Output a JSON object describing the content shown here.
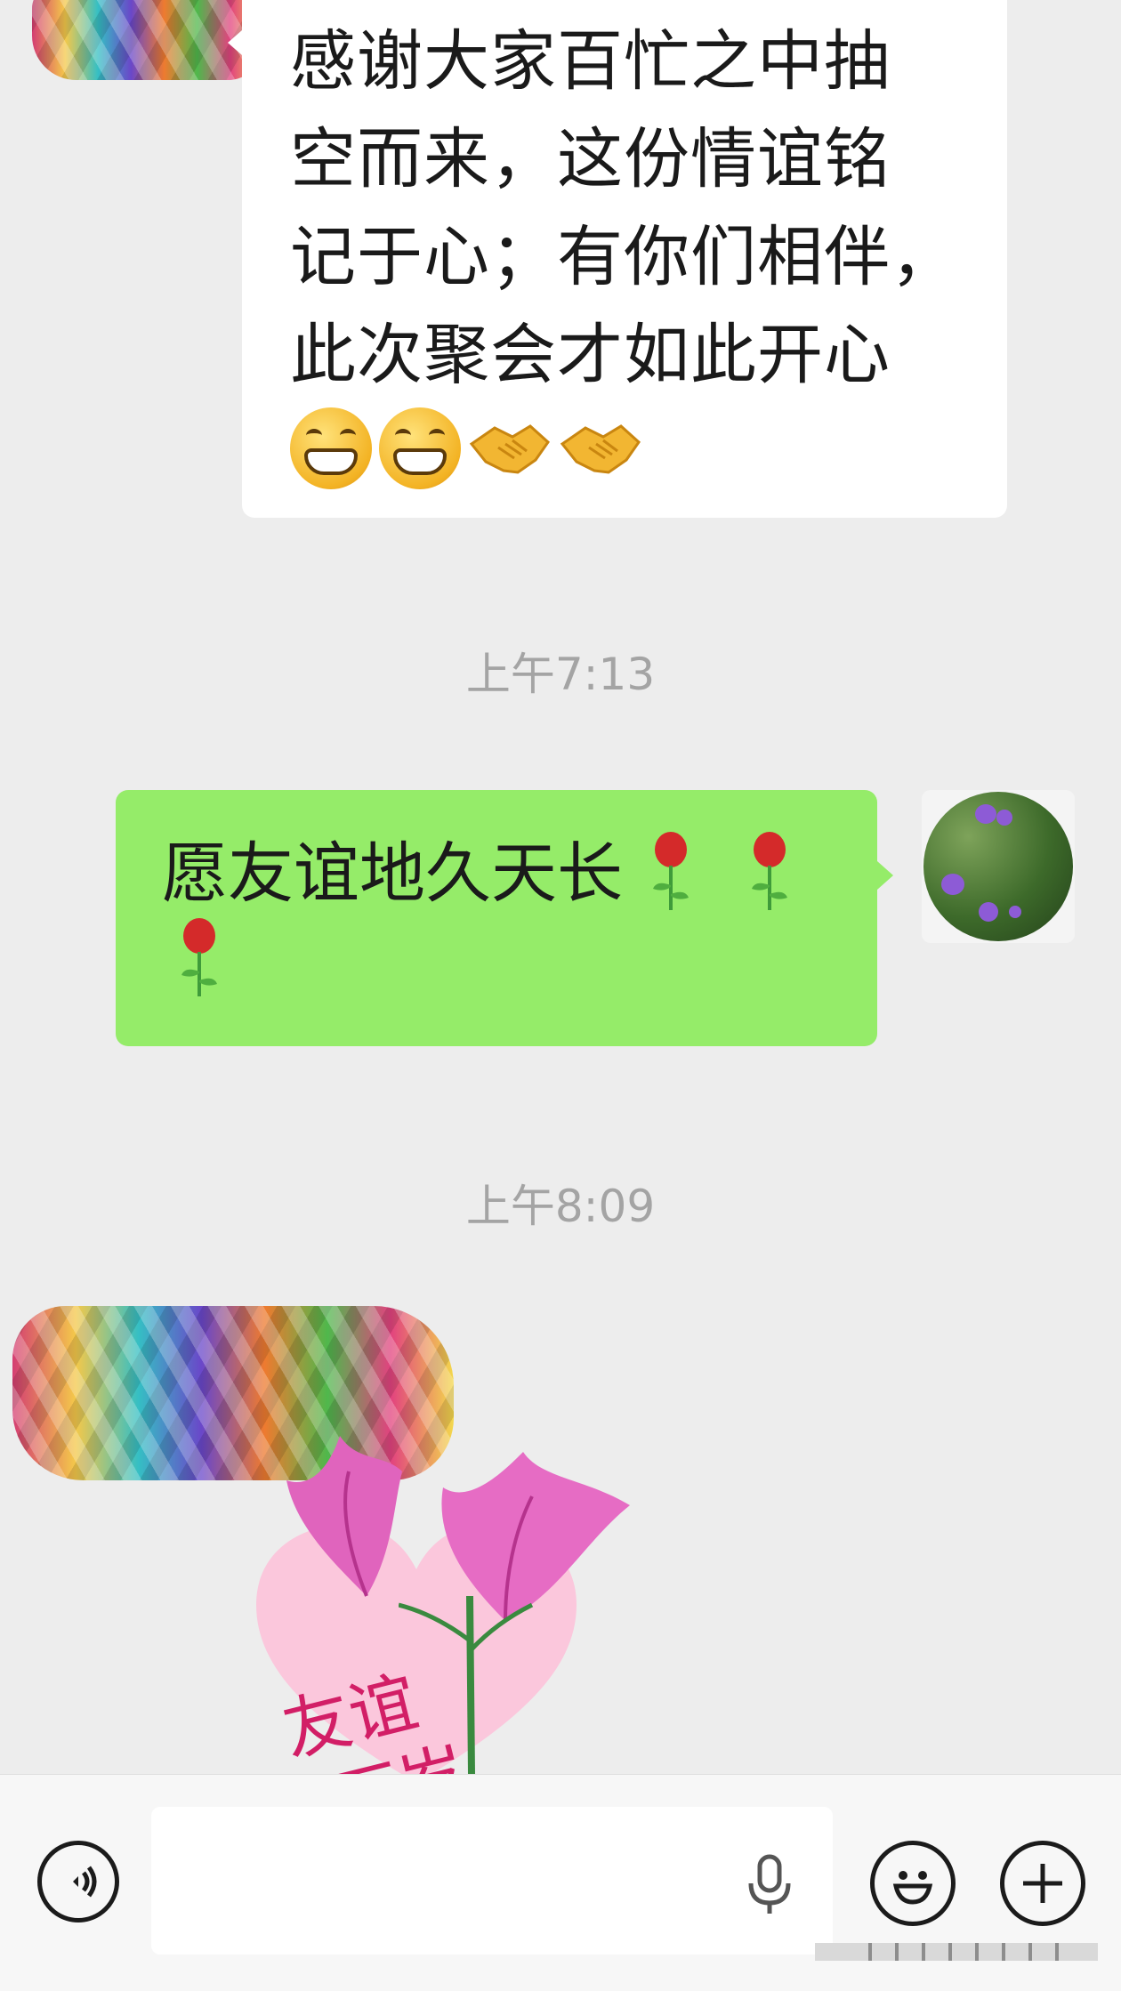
{
  "messages": [
    {
      "side": "left",
      "type": "text",
      "text": "感谢大家百忙之中抽空而来，这份情谊铭记于心；有你们相伴，此次聚会才如此开心",
      "emojis": [
        "grin-emoji",
        "grin-emoji",
        "handshake-emoji",
        "handshake-emoji"
      ]
    },
    {
      "type": "timestamp",
      "text": "上午7:13"
    },
    {
      "side": "right",
      "type": "text",
      "text": "愿友谊地久天长",
      "emojis": [
        "rose-emoji",
        "rose-emoji",
        "rose-emoji"
      ]
    },
    {
      "type": "timestamp",
      "text": "上午8:09"
    },
    {
      "side": "left",
      "type": "sticker",
      "sticker_text": "友谊万岁",
      "icon": "pink-flowers-heart-sticker"
    }
  ],
  "msg1": {
    "line1": "感谢大家百忙之中抽",
    "line2": "空而来，这份情谊铭",
    "line3": "记于心；有你们相伴，",
    "line4": "此次聚会才如此开心"
  },
  "time1": "上午7:13",
  "msg2": "愿友谊地久天长",
  "time2": "上午8:09",
  "sticker": {
    "text_a": "友谊",
    "text_b": "万岁"
  },
  "input_bar": {
    "input_value": "",
    "icons": [
      "voice-icon",
      "microphone-icon",
      "emoji-icon",
      "plus-icon"
    ]
  },
  "colors": {
    "chat_bg": "#ededed",
    "my_bubble": "#95ec69",
    "their_bubble": "#ffffff",
    "timestamp": "#a4a4a4"
  }
}
